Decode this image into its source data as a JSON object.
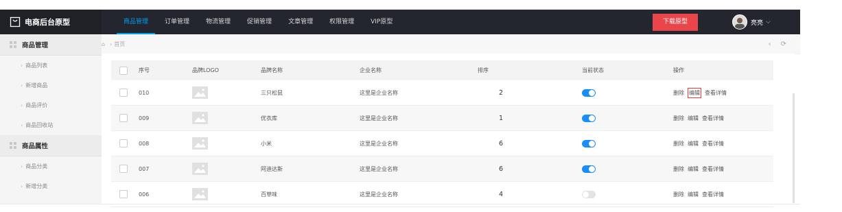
{
  "app": {
    "title": "电商后台原型"
  },
  "topnav": [
    {
      "label": "商品管理",
      "active": true
    },
    {
      "label": "订单管理"
    },
    {
      "label": "物流管理"
    },
    {
      "label": "促销管理"
    },
    {
      "label": "文章管理"
    },
    {
      "label": "权限管理"
    },
    {
      "label": "VIP原型"
    }
  ],
  "download_label": "下载原型",
  "user": {
    "name": "亮亮"
  },
  "sidebar": {
    "group1": {
      "label": "商品管理"
    },
    "group1_items": [
      {
        "label": "商品列表"
      },
      {
        "label": "新增商品"
      },
      {
        "label": "商品评价"
      },
      {
        "label": "商品回收站"
      }
    ],
    "group2": {
      "label": "商品属性"
    },
    "group2_items": [
      {
        "label": "商品分类"
      },
      {
        "label": "新增分类"
      }
    ]
  },
  "breadcrumb": {
    "home": "首页"
  },
  "table": {
    "headers": {
      "seq": "序号",
      "logo": "品牌LOGO",
      "brand": "品牌名称",
      "company": "企业名称",
      "order": "排序",
      "status": "当前状态",
      "ops": "操作"
    },
    "rows": [
      {
        "seq": "010",
        "brand": "三只松鼠",
        "company": "这里是企业名称",
        "order": "2",
        "status": "on"
      },
      {
        "seq": "009",
        "brand": "优衣库",
        "company": "这里是企业名称",
        "order": "1",
        "status": "on"
      },
      {
        "seq": "008",
        "brand": "小米",
        "company": "这里是企业名称",
        "order": "6",
        "status": "on"
      },
      {
        "seq": "007",
        "brand": "阿迪达斯",
        "company": "这里是企业名称",
        "order": "6",
        "status": "on"
      },
      {
        "seq": "006",
        "brand": "百草味",
        "company": "这里是企业名称",
        "order": "4",
        "status": "off"
      }
    ],
    "ops": {
      "delete": "删除",
      "edit": "编辑",
      "detail": "查看详情"
    }
  },
  "colors": {
    "accent": "#009ef5",
    "download": "#e8464b",
    "toggle_on": "#1a8ef5",
    "highlight": "#e43a3a"
  }
}
